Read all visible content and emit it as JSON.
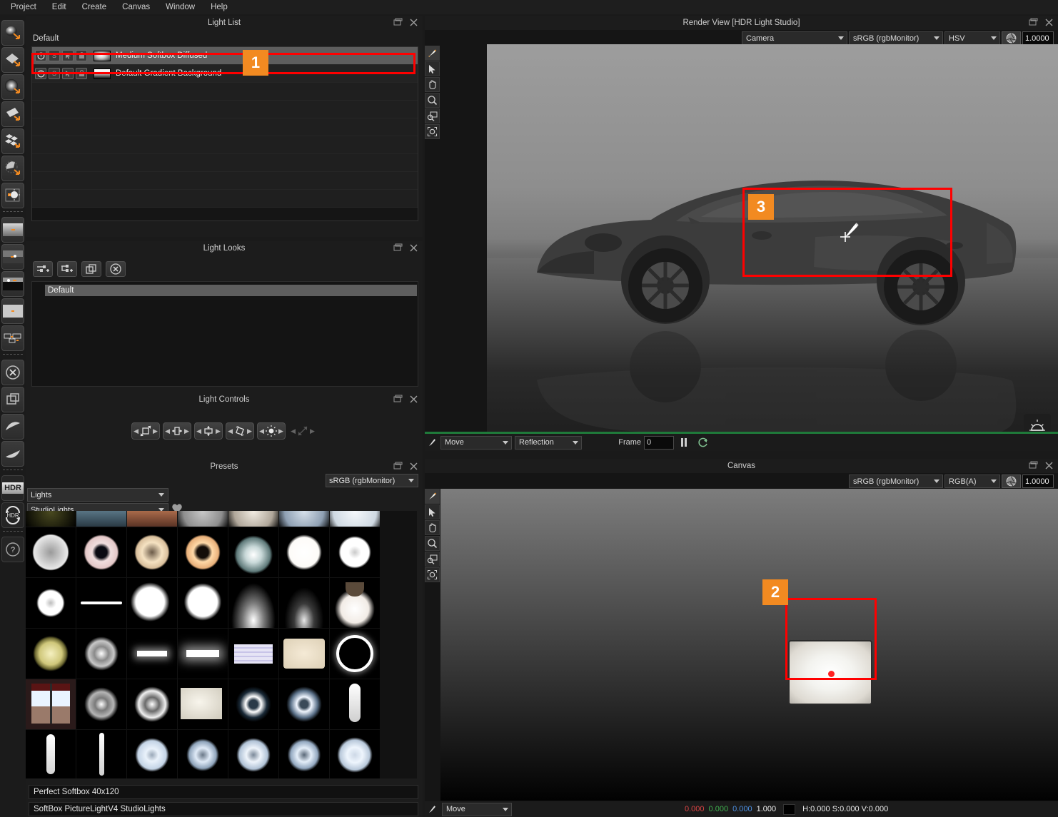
{
  "app": {
    "title": "HDR Light Studio"
  },
  "menubar": {
    "items": [
      {
        "label": "Project",
        "name": "menu-project"
      },
      {
        "label": "Edit",
        "name": "menu-edit"
      },
      {
        "label": "Create",
        "name": "menu-create"
      },
      {
        "label": "Canvas",
        "name": "menu-canvas"
      },
      {
        "label": "Window",
        "name": "menu-window"
      },
      {
        "label": "Help",
        "name": "menu-help"
      }
    ]
  },
  "rail": {
    "items": [
      {
        "icon": "area-light-icon"
      },
      {
        "icon": "diamond-light-icon"
      },
      {
        "icon": "glow-light-icon"
      },
      {
        "icon": "plane-light-icon"
      },
      {
        "icon": "checker-light-icon"
      },
      {
        "icon": "arc-light-icon"
      },
      {
        "icon": "sun-light-icon"
      },
      {
        "icon": "gradient-strip-icon"
      },
      {
        "icon": "image-strip-icon"
      },
      {
        "icon": "dark-strip-icon"
      },
      {
        "icon": "flat-panel-icon"
      },
      {
        "icon": "node-graph-icon"
      },
      {
        "icon": "delete-circle-icon"
      },
      {
        "icon": "duplicate-icon"
      },
      {
        "icon": "curve-left-icon"
      },
      {
        "icon": "curve-right-icon"
      },
      {
        "icon": "hdr-icon",
        "label": "HDR"
      },
      {
        "icon": "hdr-refresh-icon",
        "label": "HDR"
      },
      {
        "icon": "help-icon",
        "label": "?"
      }
    ]
  },
  "light_list": {
    "title": "Light List",
    "group_label": "Default",
    "row_buttons": [
      "power-toggle",
      "solo-toggle",
      "select-toggle",
      "lock-toggle"
    ],
    "rows": [
      {
        "name": "Medium Softbox Diffused",
        "selected": true,
        "thumb": "softbox-thumb"
      },
      {
        "name": "Default Gradient Background",
        "selected": false,
        "thumb": "gradient-thumb"
      }
    ],
    "empty_rows": 8
  },
  "light_looks": {
    "title": "Light Looks",
    "toolbar": [
      {
        "name": "add-look-button",
        "icon": "add-slider-icon"
      },
      {
        "name": "add-child-look-button",
        "icon": "add-branch-icon"
      },
      {
        "name": "duplicate-look-button",
        "icon": "duplicate-icon"
      },
      {
        "name": "delete-look-button",
        "icon": "delete-circle-icon"
      }
    ],
    "rows": [
      {
        "label": "Default",
        "selected": true
      }
    ]
  },
  "light_controls": {
    "title": "Light Controls",
    "buttons": [
      {
        "name": "scale-control",
        "icon": "scale-icon"
      },
      {
        "name": "width-control",
        "icon": "width-icon"
      },
      {
        "name": "height-control",
        "icon": "height-icon"
      },
      {
        "name": "rotate-control",
        "icon": "rotate-icon"
      },
      {
        "name": "intensity-control",
        "icon": "sun-icon"
      },
      {
        "name": "diagonal-scale-control",
        "icon": "diagonal-scale-icon",
        "disabled": true
      }
    ]
  },
  "presets": {
    "title": "Presets",
    "colorspace": "sRGB (rgbMonitor)",
    "category": "Lights",
    "collection": "StudioLights",
    "favourite_icon": "heart-icon",
    "selected_preset": "Perfect Softbox 40x120",
    "path_label": "SoftBox PictureLightV4 StudioLights",
    "thumbnails": [
      {
        "style": "dark-ring"
      },
      {
        "style": "window-blue"
      },
      {
        "style": "window-warm"
      },
      {
        "style": "soft-grey"
      },
      {
        "style": "soft-warm"
      },
      {
        "style": "soft-blue"
      },
      {
        "style": "soft-white"
      },
      {
        "style": "big-grey"
      },
      {
        "style": "beauty-pink"
      },
      {
        "style": "beauty-warm"
      },
      {
        "style": "beauty-orange"
      },
      {
        "style": "strobe-teal"
      },
      {
        "style": "white-soft"
      },
      {
        "style": "ring-white"
      },
      {
        "style": "ring-small"
      },
      {
        "style": "thin-bar"
      },
      {
        "style": "blob-white"
      },
      {
        "style": "blob-white2"
      },
      {
        "style": "dome-glow"
      },
      {
        "style": "dome-dim"
      },
      {
        "style": "umbrella-dark"
      },
      {
        "style": "yellow-star"
      },
      {
        "style": "grey-ring"
      },
      {
        "style": "bar-white"
      },
      {
        "style": "bar-white2"
      },
      {
        "style": "tube-panel"
      },
      {
        "style": "softbox-cream"
      },
      {
        "style": "ring-outline"
      },
      {
        "style": "window-photo"
      },
      {
        "style": "grey-ring2"
      },
      {
        "style": "grey-ring3"
      },
      {
        "style": "panel-cream"
      },
      {
        "style": "beauty-blue"
      },
      {
        "style": "beauty-blue2"
      },
      {
        "style": "strip-vert"
      },
      {
        "style": "strip-vert2"
      },
      {
        "style": "strip-thin"
      },
      {
        "style": "umbrella1"
      },
      {
        "style": "umbrella2"
      },
      {
        "style": "umbrella3"
      },
      {
        "style": "umbrella4"
      },
      {
        "style": "umbrella5"
      }
    ]
  },
  "render_view": {
    "title": "Render View [HDR Light Studio]",
    "camera": "Camera",
    "colorspace": "sRGB (rgbMonitor)",
    "channel": "HSV",
    "exposure": "1.0000",
    "aperture_icon": "aperture-icon",
    "tools": [
      "paint-icon",
      "cursor-icon",
      "hand-icon",
      "zoom-icon",
      "zoom-rect-icon",
      "zoom-fit-icon"
    ],
    "mode": "Move",
    "surface": "Reflection",
    "frame_label": "Frame",
    "frame_value": "0",
    "pause_icon": "pause-icon",
    "refresh_icon": "refresh-icon",
    "lighting_icon": "sun-horizon-icon"
  },
  "canvas": {
    "title": "Canvas",
    "colorspace": "sRGB (rgbMonitor)",
    "channel": "RGB(A)",
    "exposure": "1.0000",
    "aperture_icon": "aperture-icon",
    "tools": [
      "paint-icon",
      "cursor-icon",
      "hand-icon",
      "zoom-icon",
      "zoom-rect-icon",
      "zoom-fit-icon"
    ],
    "mode": "Move",
    "status": {
      "r": "0.000",
      "g": "0.000",
      "b": "0.000",
      "a": "1.000",
      "hsv": "H:0.000 S:0.000 V:0.000"
    }
  },
  "annotations": [
    {
      "id": "1",
      "target": "light-list-selected-row"
    },
    {
      "id": "2",
      "target": "canvas-light-handle"
    },
    {
      "id": "3",
      "target": "render-view-paint-cursor"
    }
  ],
  "colors": {
    "accent": "#f28a21",
    "highlight": "#ff0000",
    "green": "#1f7a3a"
  }
}
